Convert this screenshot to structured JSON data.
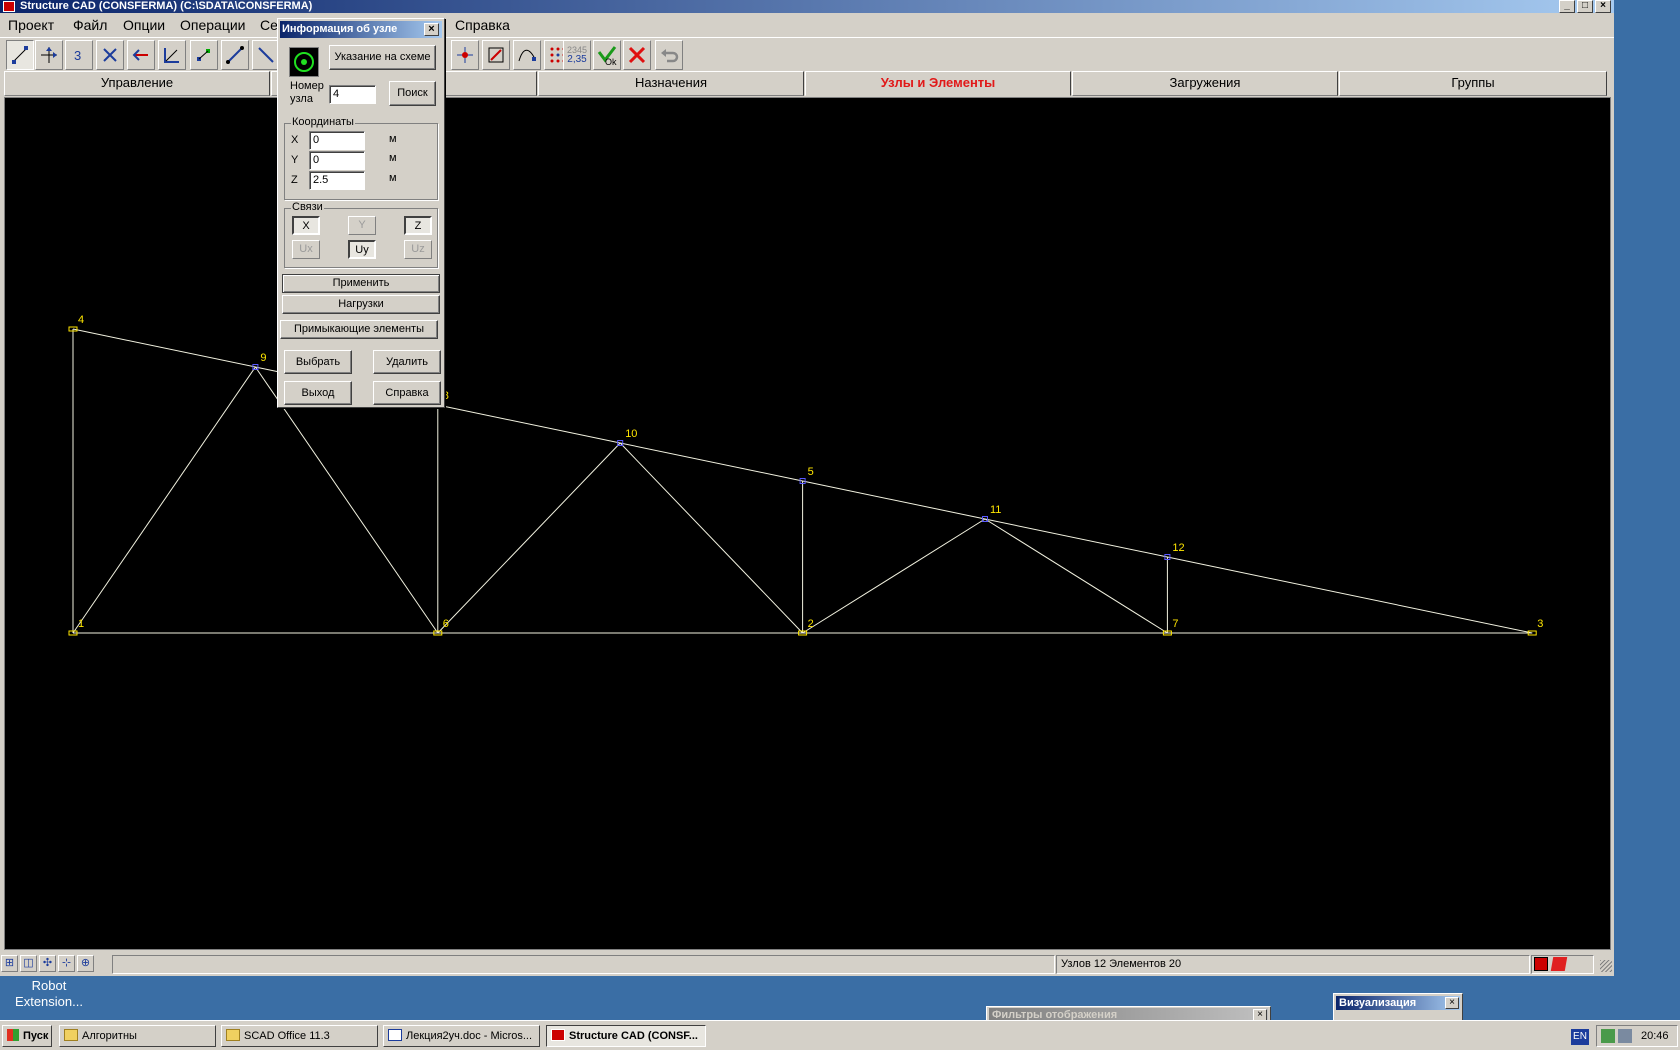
{
  "window": {
    "title": "Structure CAD (CONSFERMA) (C:\\SDATA\\CONSFERMA)",
    "min_label": "_",
    "max_label": "□",
    "close_label": "×"
  },
  "menu": [
    "Проект",
    "Файл",
    "Опции",
    "Операции",
    "Се",
    "Справка"
  ],
  "toolbar": {
    "icons": [
      "node-create-icon",
      "node-move-icon",
      "node-number-icon",
      "node-delete-icon",
      "node-join-icon",
      "node-axis-icon",
      "node-grid-icon",
      "element-add-icon",
      "element-select-icon",
      "element-edit-icon",
      "edit-points-icon",
      "curve-icon",
      "node-grid-dots-icon",
      "numbering-icon",
      "apply-ok-icon",
      "cancel-icon",
      "undo-icon"
    ],
    "numbering_top": "2345",
    "numbering_bottom": "2,35",
    "ok_label": "Ok"
  },
  "tabs": [
    {
      "label": "Управление",
      "active": false
    },
    {
      "label": "",
      "active": false
    },
    {
      "label": "Назначения",
      "active": false
    },
    {
      "label": "Узлы и Элементы",
      "active": true
    },
    {
      "label": "Загружения",
      "active": false
    },
    {
      "label": "Группы",
      "active": false
    }
  ],
  "model": {
    "nodes": [
      {
        "id": "1",
        "x": 0,
        "z": 0
      },
      {
        "id": "6",
        "x": 6,
        "z": 0
      },
      {
        "id": "2",
        "x": 12,
        "z": 0
      },
      {
        "id": "7",
        "x": 18,
        "z": 0
      },
      {
        "id": "3",
        "x": 24,
        "z": 0
      },
      {
        "id": "4",
        "x": 0,
        "z": 5
      },
      {
        "id": "9",
        "x": 3,
        "z": 4.375
      },
      {
        "id": "8",
        "x": 6,
        "z": 3.75
      },
      {
        "id": "10",
        "x": 9,
        "z": 3.125
      },
      {
        "id": "5",
        "x": 12,
        "z": 2.5
      },
      {
        "id": "11",
        "x": 15,
        "z": 1.875
      },
      {
        "id": "12",
        "x": 18,
        "z": 1.25
      }
    ],
    "elements": [
      [
        "1",
        "6"
      ],
      [
        "6",
        "2"
      ],
      [
        "2",
        "7"
      ],
      [
        "7",
        "3"
      ],
      [
        "4",
        "9"
      ],
      [
        "9",
        "8"
      ],
      [
        "8",
        "10"
      ],
      [
        "10",
        "5"
      ],
      [
        "5",
        "11"
      ],
      [
        "11",
        "12"
      ],
      [
        "12",
        "3"
      ],
      [
        "1",
        "4"
      ],
      [
        "6",
        "8"
      ],
      [
        "2",
        "5"
      ],
      [
        "7",
        "12"
      ],
      [
        "1",
        "9"
      ],
      [
        "9",
        "6"
      ],
      [
        "6",
        "10"
      ],
      [
        "10",
        "2"
      ],
      [
        "2",
        "11"
      ],
      [
        "11",
        "7"
      ]
    ],
    "supports": [
      "1",
      "6",
      "2",
      "7",
      "3",
      "4"
    ],
    "colors": {
      "background": "#000000",
      "line": "#f2f2e0",
      "label": "#ffe600",
      "node": "#5a5aff",
      "support": "#ffe600"
    }
  },
  "status": {
    "summary": "Узлов 12 Элементов 20"
  },
  "dialog": {
    "title": "Информация об узле",
    "close": "×",
    "pick_on_scheme": "Указание на схеме",
    "node_number_label_1": "Номер",
    "node_number_label_2": "узла",
    "node_number": "4",
    "search": "Поиск",
    "coords_group": "Координаты",
    "x_label": "X",
    "y_label": "Y",
    "z_label": "Z",
    "x_value": "0",
    "y_value": "0",
    "z_value": "2.5",
    "unit": "м",
    "links_group": "Связи",
    "links": {
      "x": {
        "label": "X",
        "state": "on"
      },
      "y": {
        "label": "Y",
        "state": "off"
      },
      "z": {
        "label": "Z",
        "state": "on"
      },
      "ux": {
        "label": "Ux",
        "state": "off"
      },
      "uy": {
        "label": "Uy",
        "state": "on"
      },
      "uz": {
        "label": "Uz",
        "state": "off"
      }
    },
    "apply": "Применить",
    "loads": "Нагрузки",
    "adjacent": "Примыкающие элементы",
    "select": "Выбрать",
    "delete": "Удалить",
    "exit": "Выход",
    "help": "Справка"
  },
  "desktop": {
    "robot_line1": "Robot",
    "robot_line2": "Extension...",
    "filter_title": "Фильтры отображения",
    "vis_title": "Визуализация"
  },
  "taskbar": {
    "start": "Пуск",
    "items": [
      {
        "label": "Алгоритны",
        "icon": "folder-icon",
        "active": false
      },
      {
        "label": "SCAD Office 11.3",
        "icon": "folder-icon",
        "active": false
      },
      {
        "label": "Лекция2уч.doc - Micros...",
        "icon": "word-doc-icon",
        "active": false
      },
      {
        "label": "Structure CAD (CONSF...",
        "icon": "scad-app-icon",
        "active": true
      }
    ],
    "lang": "EN",
    "time": "20:46"
  }
}
